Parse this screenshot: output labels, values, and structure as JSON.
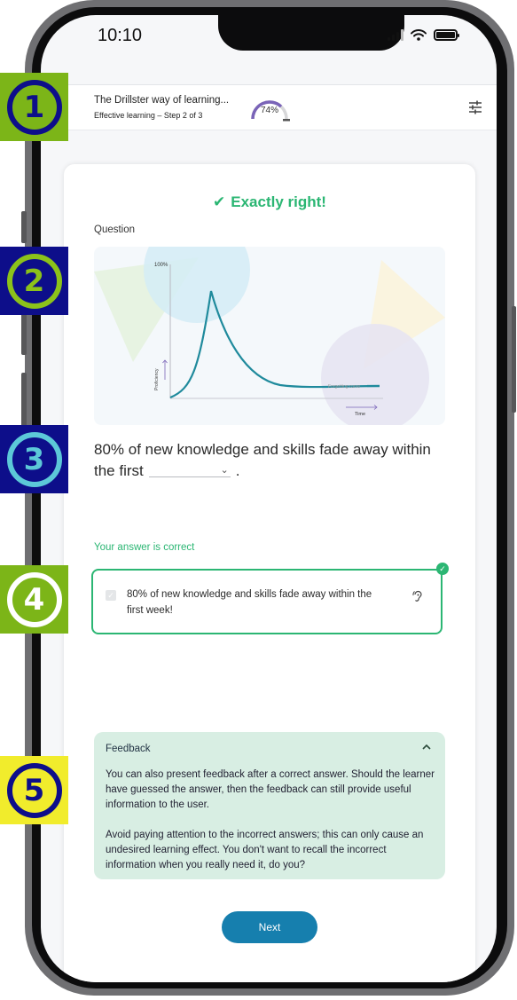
{
  "status_bar": {
    "time": "10:10"
  },
  "header": {
    "title": "The Drillster way of learning...",
    "subtitle": "Effective learning – Step 2 of 3",
    "progress_percent": 74,
    "progress_label": "74%",
    "settings_icon": "sliders-icon"
  },
  "card": {
    "result_icon": "checkmark-icon",
    "result_text": "Exactly right!",
    "question_label": "Question",
    "illustration": {
      "y_top_label": "100%",
      "y_axis_label": "Proficiency",
      "x_axis_label": "Time",
      "legend": "Forgetting curve"
    },
    "question_part1": "80% of new knowledge and skills fade away within the first",
    "question_end": ".",
    "blank_icon": "chevron-down-icon",
    "answer_status": "Your answer is correct",
    "answer_text": "80% of new knowledge and skills fade away within the first week!",
    "answer_badge_icon": "check-circle-icon",
    "answer_audio_icon": "ear-icon",
    "feedback": {
      "title": "Feedback",
      "toggle_icon": "chevron-up-icon",
      "paragraphs": [
        "You can also present feedback after a correct answer. Should the learner have guessed the answer, then the feedback can still provide useful information to the user.",
        "Avoid paying attention to the incorrect answers; this can only cause an undesired learning effect. You don't want to recall the incorrect information when you really need it, do you?"
      ]
    },
    "next_label": "Next"
  },
  "markers": [
    {
      "number": "1",
      "bg": "#7cb518",
      "ring": "#0d0e8a",
      "digit": "#0d0e8a"
    },
    {
      "number": "2",
      "bg": "#0d0e8a",
      "ring": "#8cc21a",
      "digit": "#8cc21a"
    },
    {
      "number": "3",
      "bg": "#0d0e8a",
      "ring": "#5cc8d8",
      "digit": "#5cc8d8"
    },
    {
      "number": "4",
      "bg": "#7cb518",
      "ring": "#ffffff",
      "digit": "#ffffff"
    },
    {
      "number": "5",
      "bg": "#f1ec2c",
      "ring": "#0d0e8a",
      "digit": "#0d0e8a"
    }
  ],
  "colors": {
    "success": "#2bb673",
    "primary": "#167fae",
    "gauge": "#7a64b8",
    "feedback_bg": "#d8eee3",
    "curve": "#1f8a9c"
  }
}
